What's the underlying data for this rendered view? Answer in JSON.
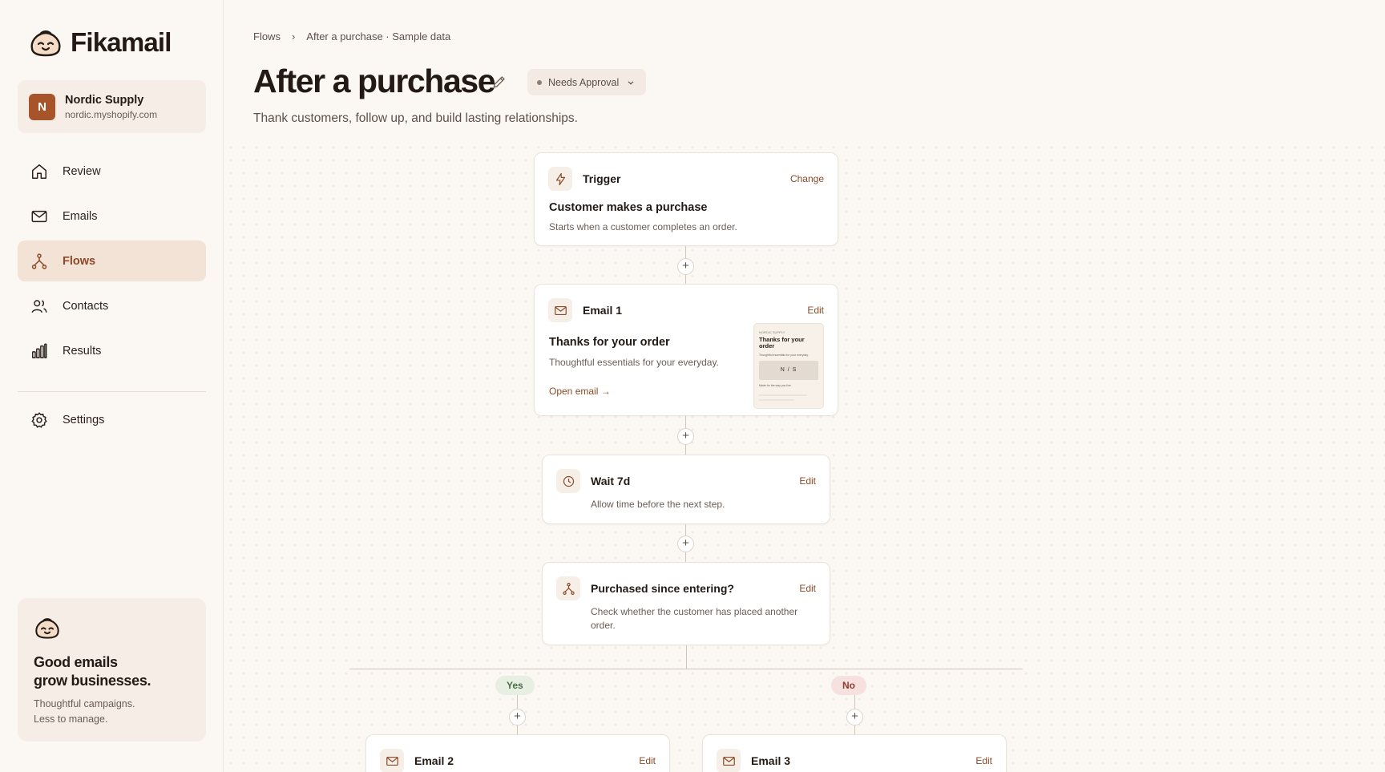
{
  "brand": {
    "name": "Fikamail"
  },
  "store": {
    "initial": "N",
    "name": "Nordic Supply",
    "url": "nordic.myshopify.com"
  },
  "nav": {
    "items": [
      {
        "label": "Review",
        "icon": "home-icon"
      },
      {
        "label": "Emails",
        "icon": "mail-icon"
      },
      {
        "label": "Flows",
        "icon": "flow-icon",
        "active": true
      },
      {
        "label": "Contacts",
        "icon": "users-icon"
      },
      {
        "label": "Results",
        "icon": "bar-chart-icon"
      }
    ],
    "settings": {
      "label": "Settings",
      "icon": "gear-icon"
    }
  },
  "promo": {
    "title_line1": "Good emails",
    "title_line2": "grow businesses.",
    "text_line1": "Thoughtful campaigns.",
    "text_line2": "Less to manage."
  },
  "header": {
    "breadcrumb": [
      "Flows",
      "›",
      "After a purchase · Sample data"
    ],
    "title": "After a purchase",
    "status": "Needs Approval",
    "subtitle": "Thank customers, follow up, and build lasting relationships."
  },
  "flow": {
    "trigger": {
      "title": "Trigger",
      "action": "Change",
      "heading": "Customer makes a purchase",
      "desc": "Starts when a customer completes an order."
    },
    "email1": {
      "title": "Email 1",
      "action": "Edit",
      "heading": "Thanks for your order",
      "desc": "Thoughtful essentials for your everyday.",
      "link": "Open email →",
      "thumb": {
        "brand": "NORDIC SUPPLY",
        "heading": "Thanks for your order",
        "sub": "Thoughtful essentials for your everyday.",
        "logo": "N / S",
        "footer": "Made for the way you live."
      }
    },
    "wait": {
      "title": "Wait 7d",
      "action": "Edit",
      "desc": "Allow time before the next step."
    },
    "condition": {
      "title": "Purchased since entering?",
      "action": "Edit",
      "desc_line1": "Check whether the customer has placed another",
      "desc_line2": "order."
    },
    "branches": {
      "yes": "Yes",
      "no": "No"
    },
    "email2": {
      "title": "Email 2",
      "action": "Edit"
    },
    "email3": {
      "title": "Email 3",
      "action": "Edit"
    },
    "plus": "+"
  },
  "colors": {
    "accent": "#8a4a27",
    "avatar": "#a8542b",
    "active_bg": "#f3e3d7"
  }
}
